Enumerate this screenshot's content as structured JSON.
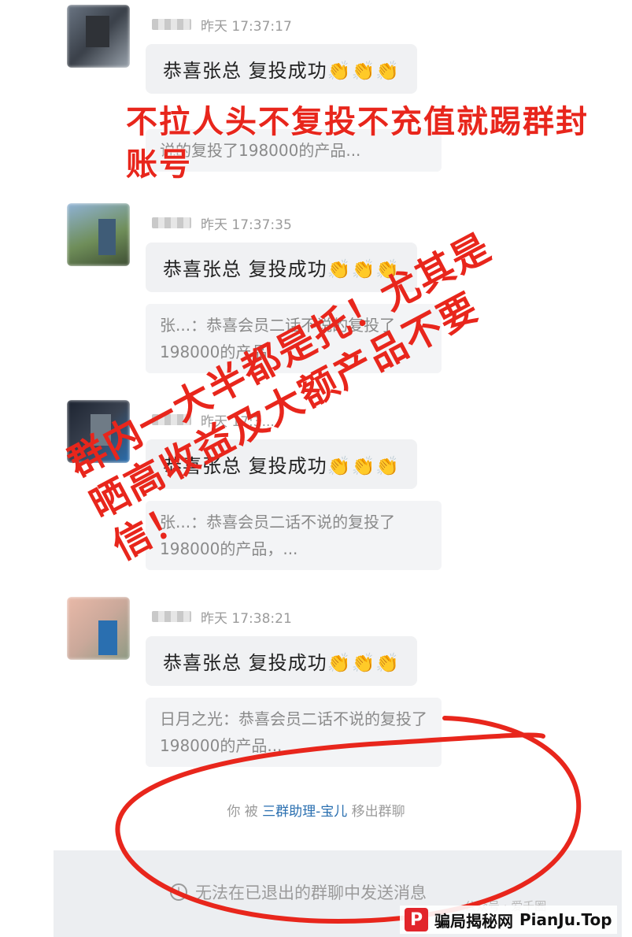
{
  "messages": [
    {
      "time": "昨天 17:37:17",
      "text": "恭喜张总  复投成功👏👏👏",
      "quote": "说的复投了198000的产品..."
    },
    {
      "time": "昨天 17:37:35",
      "text": "恭喜张总  复投成功👏👏👏",
      "quote": "张​...：恭喜会员二话不说的复投了198000的产品"
    },
    {
      "time": "昨天 17:3...",
      "text": "恭喜张总  复投成功👏👏👏",
      "quote": "张...：恭喜会员二话不说的复投了198000的产品，..."
    },
    {
      "time": "昨天 17:38:21",
      "text": "恭喜张总  复投成功👏👏👏",
      "quote": "日月之光：恭喜会员二话不说的复投了198000的产品..."
    }
  ],
  "system": {
    "you": "你 被",
    "nick": "三群助理-宝儿",
    "action": "移出群聊"
  },
  "input_notice": "无法在已退出的群聊中发送消息",
  "watermark_gz": "公众号 · 爱千圈",
  "overlay": {
    "top_caption": "不拉人头不复投不充值就踢群封账号",
    "diag_caption": "群内一大半都是托！尤其是晒高收益及大额产品不要信！"
  },
  "brand": {
    "logo": "P",
    "cn": "骗局揭秘网",
    "en": "PianJu.Top"
  },
  "colors": {
    "accent_red": "#e8261c",
    "bubble": "#f0f1f3",
    "nick_blue": "#2a6fb0"
  }
}
